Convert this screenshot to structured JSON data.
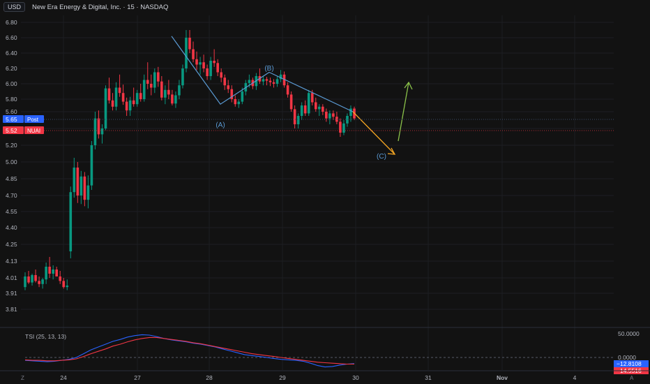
{
  "header": {
    "currency": "USD",
    "title": "New Era Energy & Digital, Inc. · 15 · NASDAQ"
  },
  "price_axis_ticks": [
    "6.80",
    "6.60",
    "6.40",
    "6.20",
    "6.00",
    "5.80",
    "5.60",
    "5.40",
    "5.20",
    "5.00",
    "4.85",
    "4.70",
    "4.55",
    "4.40",
    "4.25",
    "4.13",
    "4.01",
    "3.91",
    "3.81"
  ],
  "price_badges": {
    "post": {
      "value": "5.65",
      "label": "Post",
      "color": "#2962ff"
    },
    "last": {
      "value": "5.52",
      "label": "NUAI",
      "color": "#f23645"
    }
  },
  "wave_labels": [
    "(A)",
    "(B)",
    "(C)"
  ],
  "indicator": {
    "label": "TSI (25, 13, 13)",
    "axis_ticks": [
      "50.0000",
      "0.0000"
    ],
    "tsi_value": "−12.8108",
    "signal_value": "−14.5516",
    "tsi_color": "#2962ff",
    "signal_color": "#f23645"
  },
  "time_axis": [
    "24",
    "27",
    "28",
    "29",
    "30",
    "31",
    "Nov",
    "4"
  ],
  "corner_icons": {
    "left": "Z",
    "right": "A"
  },
  "colors": {
    "up": "#089981",
    "down": "#f23645",
    "bg": "#121212",
    "wave_line": "#5b9bd5",
    "arrow_down": "#f5a623",
    "arrow_up": "#8bc34a"
  },
  "chart_data": {
    "type": "candlestick",
    "ylim": [
      3.81,
      6.8
    ],
    "candles": [
      [
        3.95,
        4.05,
        3.93,
        4.02
      ],
      [
        4.02,
        4.06,
        3.97,
        3.98
      ],
      [
        3.98,
        4.04,
        3.96,
        4.03
      ],
      [
        4.03,
        4.07,
        3.98,
        3.99
      ],
      [
        3.99,
        4.02,
        3.95,
        3.97
      ],
      [
        3.97,
        4.01,
        3.94,
        4.0
      ],
      [
        4.0,
        4.12,
        3.97,
        4.09
      ],
      [
        4.09,
        4.16,
        4.01,
        4.04
      ],
      [
        4.04,
        4.1,
        4.0,
        4.07
      ],
      [
        4.07,
        4.09,
        4.02,
        4.02
      ],
      [
        4.02,
        4.06,
        3.97,
        3.99
      ],
      [
        3.99,
        4.01,
        3.94,
        3.95
      ],
      [
        3.95,
        4.0,
        3.93,
        3.96
      ],
      [
        4.2,
        4.78,
        4.15,
        4.73
      ],
      [
        4.73,
        5.05,
        4.68,
        4.95
      ],
      [
        4.95,
        5.0,
        4.63,
        4.7
      ],
      [
        4.7,
        4.92,
        4.62,
        4.87
      ],
      [
        4.87,
        4.91,
        4.6,
        4.66
      ],
      [
        4.66,
        4.88,
        4.58,
        4.79
      ],
      [
        4.79,
        5.25,
        4.75,
        5.2
      ],
      [
        5.2,
        5.6,
        5.15,
        5.52
      ],
      [
        5.52,
        5.62,
        5.28,
        5.33
      ],
      [
        5.33,
        5.45,
        5.22,
        5.4
      ],
      [
        5.4,
        5.98,
        5.38,
        5.94
      ],
      [
        5.94,
        6.08,
        5.73,
        5.78
      ],
      [
        5.78,
        5.88,
        5.62,
        5.68
      ],
      [
        5.68,
        6.02,
        5.62,
        5.95
      ],
      [
        5.95,
        6.12,
        5.83,
        5.88
      ],
      [
        5.88,
        5.99,
        5.71,
        5.76
      ],
      [
        5.76,
        5.82,
        5.55,
        5.62
      ],
      [
        5.62,
        5.83,
        5.55,
        5.78
      ],
      [
        5.78,
        5.95,
        5.68,
        5.72
      ],
      [
        5.72,
        5.92,
        5.68,
        5.88
      ],
      [
        5.88,
        6.0,
        5.76,
        5.8
      ],
      [
        5.8,
        6.12,
        5.76,
        6.05
      ],
      [
        6.05,
        6.28,
        5.93,
        6.0
      ],
      [
        6.0,
        6.12,
        5.85,
        5.95
      ],
      [
        5.95,
        6.2,
        5.88,
        6.15
      ],
      [
        6.15,
        6.22,
        5.96,
        6.03
      ],
      [
        6.03,
        6.1,
        5.78,
        5.82
      ],
      [
        5.82,
        5.98,
        5.72,
        5.92
      ],
      [
        5.92,
        6.05,
        5.8,
        5.86
      ],
      [
        5.86,
        5.92,
        5.7,
        5.73
      ],
      [
        5.73,
        5.9,
        5.66,
        5.85
      ],
      [
        5.85,
        6.05,
        5.8,
        5.98
      ],
      [
        5.98,
        6.25,
        5.94,
        6.2
      ],
      [
        6.2,
        6.7,
        6.15,
        6.6
      ],
      [
        6.6,
        6.7,
        6.4,
        6.45
      ],
      [
        6.45,
        6.55,
        6.28,
        6.32
      ],
      [
        6.32,
        6.42,
        6.18,
        6.25
      ],
      [
        6.25,
        6.35,
        6.12,
        6.28
      ],
      [
        6.28,
        6.38,
        6.15,
        6.2
      ],
      [
        6.2,
        6.25,
        6.05,
        6.1
      ],
      [
        6.1,
        6.35,
        6.05,
        6.3
      ],
      [
        6.3,
        6.45,
        6.22,
        6.27
      ],
      [
        6.27,
        6.32,
        6.1,
        6.15
      ],
      [
        6.15,
        6.2,
        6.02,
        6.08
      ],
      [
        6.08,
        6.12,
        5.92,
        5.98
      ],
      [
        5.98,
        6.05,
        5.88,
        5.93
      ],
      [
        5.93,
        5.98,
        5.75,
        5.8
      ],
      [
        5.8,
        5.85,
        5.68,
        5.72
      ],
      [
        5.72,
        5.8,
        5.66,
        5.76
      ],
      [
        5.76,
        5.95,
        5.72,
        5.9
      ],
      [
        5.9,
        6.05,
        5.85,
        6.01
      ],
      [
        6.01,
        6.12,
        5.95,
        6.05
      ],
      [
        6.05,
        6.08,
        5.93,
        5.97
      ],
      [
        5.97,
        6.14,
        5.92,
        6.1
      ],
      [
        6.1,
        6.2,
        6.0,
        6.03
      ],
      [
        6.03,
        6.1,
        5.98,
        6.06
      ],
      [
        6.06,
        6.09,
        5.98,
        6.04
      ],
      [
        6.04,
        6.08,
        5.97,
        6.02
      ],
      [
        6.02,
        6.06,
        5.95,
        6.0
      ],
      [
        6.0,
        6.1,
        5.96,
        6.06
      ],
      [
        6.06,
        6.18,
        6.02,
        6.12
      ],
      [
        6.12,
        6.16,
        5.95,
        5.98
      ],
      [
        5.98,
        6.02,
        5.82,
        5.86
      ],
      [
        5.86,
        5.9,
        5.6,
        5.64
      ],
      [
        5.64,
        5.7,
        5.4,
        5.45
      ],
      [
        5.45,
        5.58,
        5.4,
        5.55
      ],
      [
        5.55,
        5.75,
        5.5,
        5.7
      ],
      [
        5.7,
        5.78,
        5.55,
        5.58
      ],
      [
        5.58,
        5.92,
        5.55,
        5.88
      ],
      [
        5.88,
        5.92,
        5.7,
        5.75
      ],
      [
        5.75,
        5.82,
        5.6,
        5.64
      ],
      [
        5.64,
        5.72,
        5.55,
        5.68
      ],
      [
        5.68,
        5.72,
        5.56,
        5.6
      ],
      [
        5.6,
        5.65,
        5.48,
        5.52
      ],
      [
        5.52,
        5.62,
        5.45,
        5.58
      ],
      [
        5.58,
        5.62,
        5.5,
        5.54
      ],
      [
        5.54,
        5.6,
        5.45,
        5.48
      ],
      [
        5.48,
        5.52,
        5.3,
        5.35
      ],
      [
        5.35,
        5.5,
        5.32,
        5.46
      ],
      [
        5.46,
        5.58,
        5.42,
        5.55
      ],
      [
        5.55,
        5.7,
        5.48,
        5.65
      ],
      [
        5.65,
        5.68,
        5.5,
        5.52
      ]
    ],
    "wave_points": [
      {
        "label": "start",
        "price": 6.62
      },
      {
        "label": "(A)",
        "price": 5.72
      },
      {
        "label": "(B)",
        "price": 6.15
      },
      {
        "label": "end",
        "price": 5.6
      }
    ],
    "tsi_scale": [
      -25,
      65
    ],
    "tsi": [
      -6,
      -7,
      -8,
      -9,
      -8,
      -6,
      -4,
      0,
      8,
      16,
      22,
      28,
      34,
      38,
      43,
      46,
      48,
      47,
      44,
      40,
      37,
      35,
      33,
      30,
      28,
      25,
      22,
      18,
      14,
      10,
      6,
      4,
      2,
      0,
      -2,
      -4,
      -5,
      -6,
      -8,
      -12,
      -17,
      -20,
      -19,
      -16,
      -14,
      -13
    ],
    "signal": [
      -5,
      -6,
      -6,
      -7,
      -7,
      -6,
      -5,
      -3,
      2,
      8,
      13,
      18,
      24,
      28,
      33,
      37,
      40,
      42,
      42,
      40,
      38,
      36,
      34,
      31,
      29,
      26,
      23,
      20,
      17,
      14,
      11,
      8,
      6,
      4,
      2,
      0,
      -2,
      -4,
      -6,
      -8,
      -10,
      -11,
      -12,
      -13,
      -14,
      -14
    ]
  }
}
